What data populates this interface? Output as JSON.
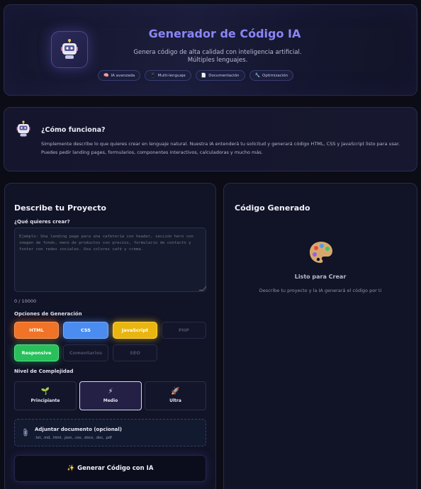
{
  "header": {
    "title": "Generador de Código IA",
    "subtitle_line1": "Genera código de alta calidad con inteligencia artificial.",
    "subtitle_line2": "Múltiples lenguajes.",
    "tags": [
      {
        "icon": "🧠",
        "label": "IA avanzada"
      },
      {
        "icon": "📱",
        "label": "Multi-lenguaje"
      },
      {
        "icon": "📄",
        "label": "Documentación"
      },
      {
        "icon": "🔧",
        "label": "Optimización"
      }
    ]
  },
  "how": {
    "title": "¿Cómo funciona?",
    "text": "Simplemente describe lo que quieres crear en lenguaje natural. Nuestra IA entenderá tu solicitud y generará código HTML, CSS y JavaScript listo para usar. Puedes pedir landing pages, formularios, componentes interactivos, calculadoras y mucho más."
  },
  "left": {
    "title": "Describe tu Proyecto",
    "prompt_label": "¿Qué quieres crear?",
    "prompt_placeholder": "Ejemplo: Una landing page para una cafetería con header, sección hero con imagen de fondo, menú de productos con precios, formulario de contacto y footer con redes sociales. Usa colores café y crema.",
    "counter": "0 / 10000",
    "options_label": "Opciones de Generación",
    "options": [
      {
        "label": "HTML",
        "active": true,
        "color": "#f07328"
      },
      {
        "label": "CSS",
        "active": true,
        "color": "#4a8cf0"
      },
      {
        "label": "JavaScript",
        "active": true,
        "color": "#e9b611"
      },
      {
        "label": "PHP",
        "active": false
      },
      {
        "label": "Responsive",
        "active": true,
        "color": "#27c05a"
      },
      {
        "label": "Comentarios",
        "active": false
      },
      {
        "label": "SEO",
        "active": false
      }
    ],
    "complexity_label": "Nivel de Complejidad",
    "levels": [
      {
        "icon": "🌱",
        "label": "Principiante",
        "selected": false
      },
      {
        "icon": "⚡",
        "label": "Medio",
        "selected": true
      },
      {
        "icon": "🚀",
        "label": "Ultra",
        "selected": false
      }
    ],
    "attach_icon": "paperclip-icon",
    "attach_title": "Adjuntar documento (opcional)",
    "attach_formats": ".txt, .md, .html, .json, .csv, .docx, .doc, .pdf",
    "generate_icon": "✨",
    "generate_label": "Generar Código con IA"
  },
  "right": {
    "title": "Código Generado",
    "empty_icon": "palette-icon",
    "ready": "Listo para Crear",
    "desc": "Describe tu proyecto y la IA generará el código por ti"
  }
}
